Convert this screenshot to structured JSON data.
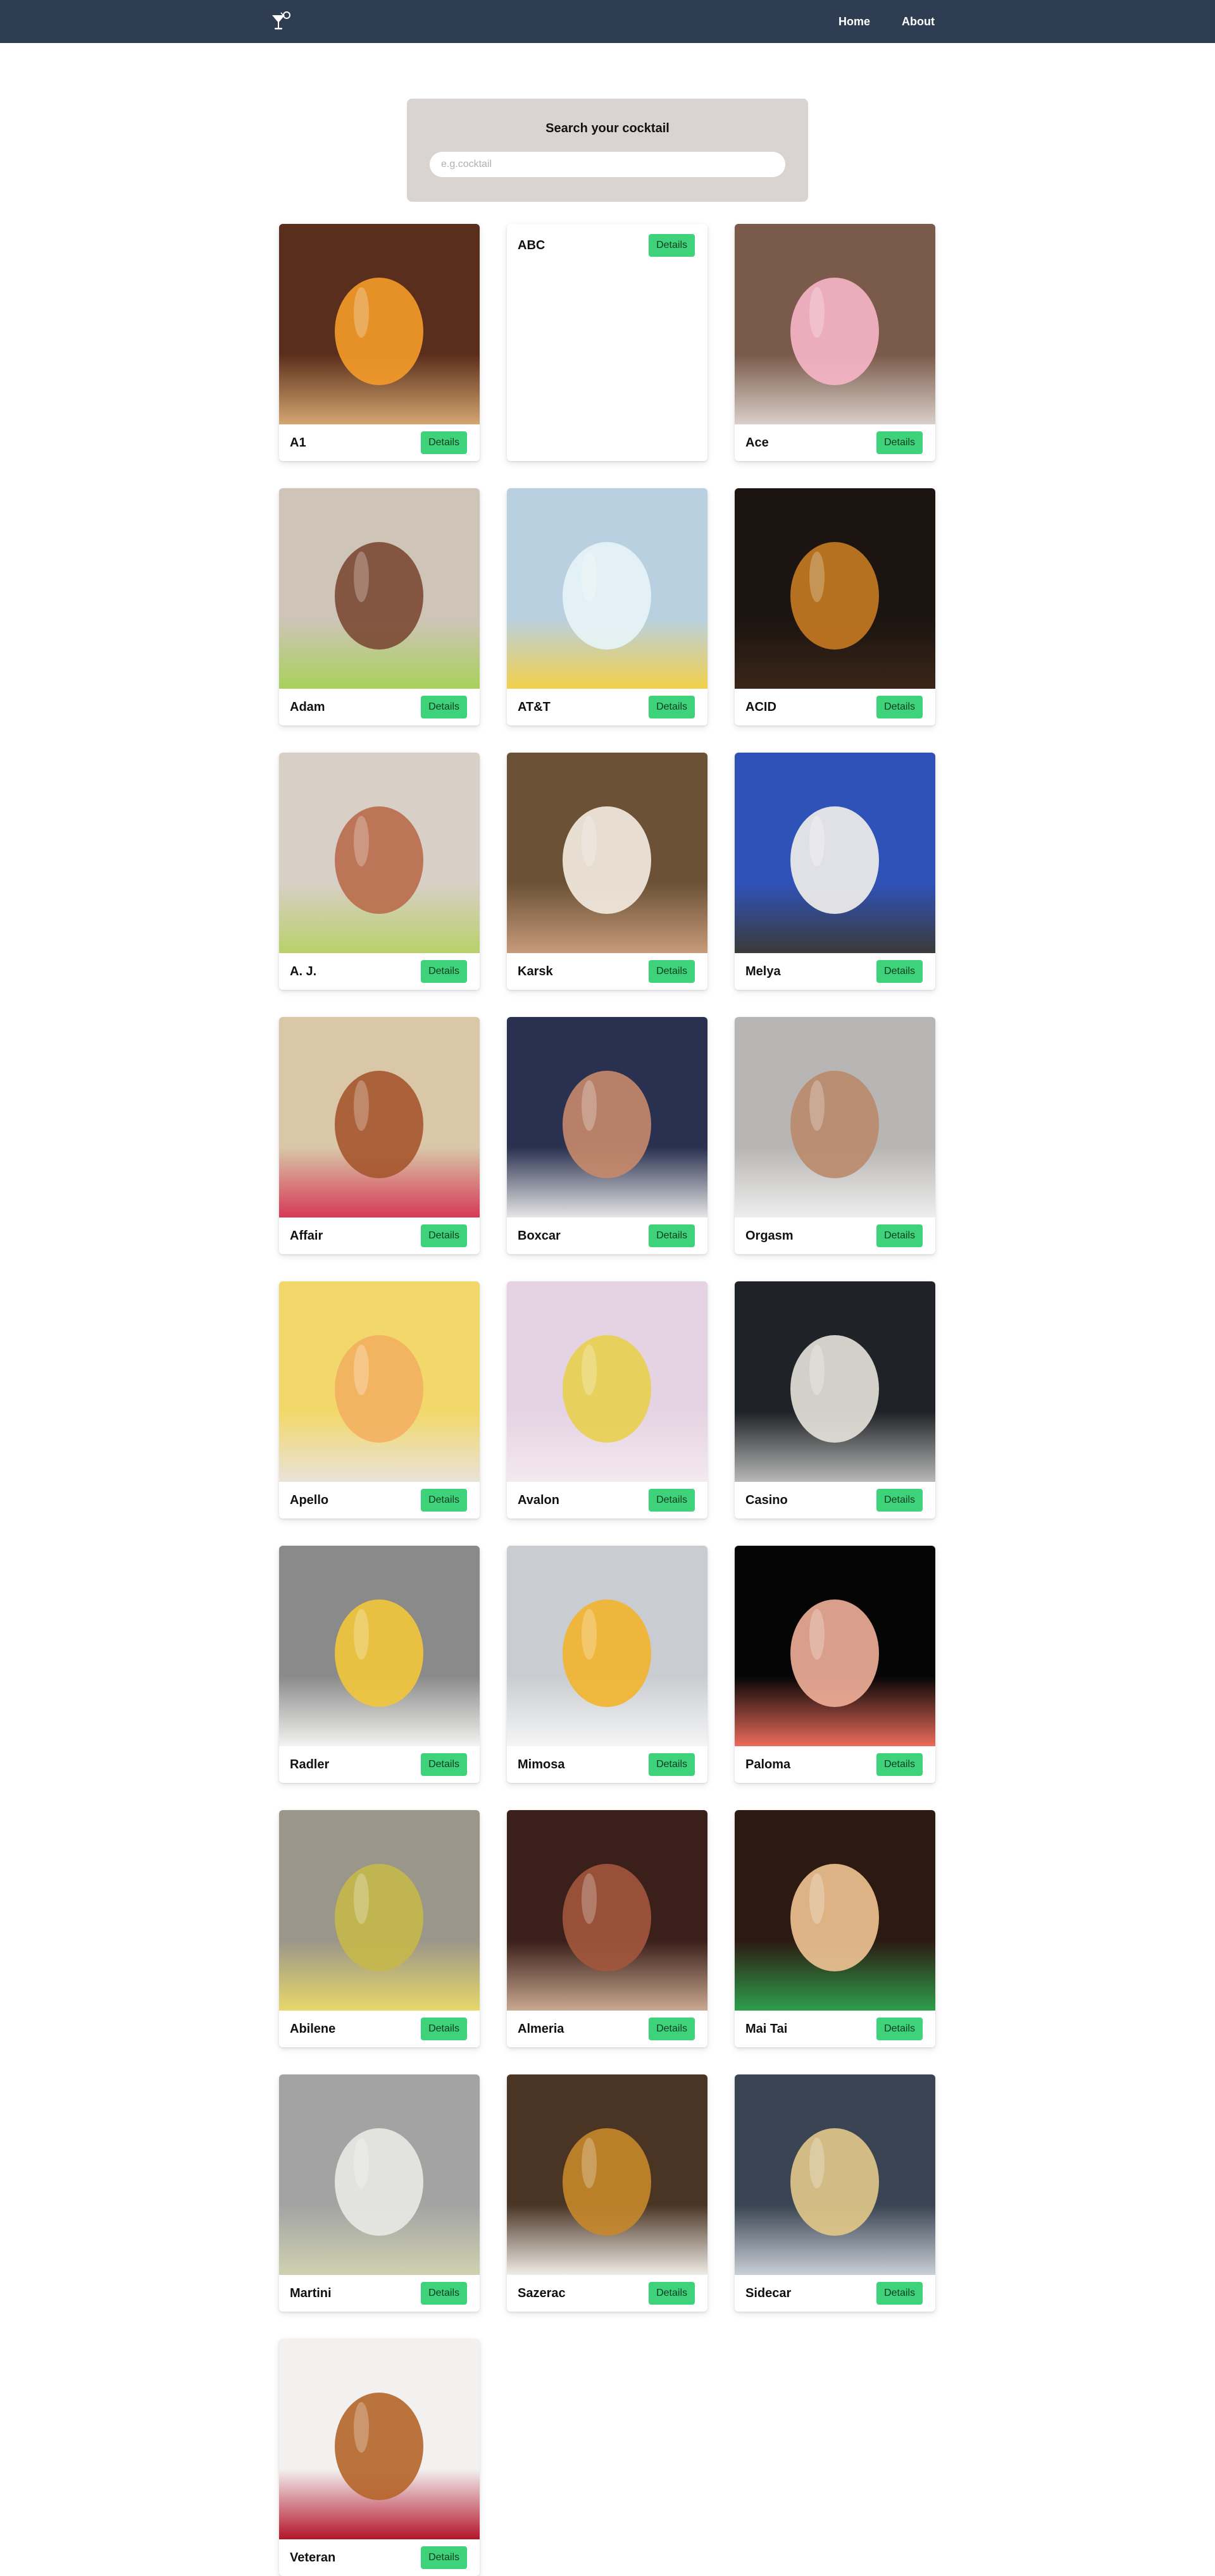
{
  "nav": {
    "logo_icon": "cocktail-glass-icon",
    "links": [
      "Home",
      "About"
    ]
  },
  "search": {
    "label": "Search your cocktail",
    "placeholder": "e.g.cocktail",
    "value": ""
  },
  "colors": {
    "navbar_bg": "#2f3d52",
    "search_panel_bg": "#d9d4d2",
    "details_button": "#3ed37a"
  },
  "details_label": "Details",
  "cocktails": [
    {
      "name": "A1",
      "has_image": true,
      "img": [
        "#5a2e1c",
        "#f59b2a",
        "#d4a670"
      ]
    },
    {
      "name": "ABC",
      "has_image": false,
      "img": null
    },
    {
      "name": "Ace",
      "has_image": true,
      "img": [
        "#7a5a4a",
        "#f7b6c8",
        "#d9cfc9"
      ]
    },
    {
      "name": "Adam",
      "has_image": true,
      "img": [
        "#cfc4b8",
        "#7b4a34",
        "#a8d15a"
      ]
    },
    {
      "name": "AT&T",
      "has_image": true,
      "img": [
        "#b9d0e0",
        "#e8f3f7",
        "#f2d04a"
      ]
    },
    {
      "name": "ACID",
      "has_image": true,
      "img": [
        "#1b1410",
        "#c77a22",
        "#3a2618"
      ]
    },
    {
      "name": "A. J.",
      "has_image": true,
      "img": [
        "#d8cfc6",
        "#b96c4a",
        "#b9d06a"
      ]
    },
    {
      "name": "Karsk",
      "has_image": true,
      "img": [
        "#6b5236",
        "#f5ece2",
        "#c89a7a"
      ]
    },
    {
      "name": "Melya",
      "has_image": true,
      "img": [
        "#2f52b8",
        "#f4f1ec",
        "#3b3a3a"
      ]
    },
    {
      "name": "Affair",
      "has_image": true,
      "img": [
        "#d9c7a8",
        "#a5562e",
        "#d63a57"
      ]
    },
    {
      "name": "Boxcar",
      "has_image": true,
      "img": [
        "#2a3150",
        "#c88a6a",
        "#e6e6e6"
      ]
    },
    {
      "name": "Orgasm",
      "has_image": true,
      "img": [
        "#b8b6b4",
        "#b98a6a",
        "#eeeeee"
      ]
    },
    {
      "name": "Apello",
      "has_image": true,
      "img": [
        "#f2d86a",
        "#f3b060",
        "#e9e2d9"
      ]
    },
    {
      "name": "Avalon",
      "has_image": true,
      "img": [
        "#e5d3e3",
        "#e8cf4c",
        "#f4e9ef"
      ]
    },
    {
      "name": "Casino",
      "has_image": true,
      "img": [
        "#1f2226",
        "#e6e3dc",
        "#b8b8b8"
      ]
    },
    {
      "name": "Radler",
      "has_image": true,
      "img": [
        "#8a8a8a",
        "#f2c63a",
        "#f3f3f1"
      ]
    },
    {
      "name": "Mimosa",
      "has_image": true,
      "img": [
        "#c9ccd0",
        "#f3b42c",
        "#f5f5f5"
      ]
    },
    {
      "name": "Paloma",
      "has_image": true,
      "img": [
        "#050505",
        "#f2b09a",
        "#eb6b5b"
      ]
    },
    {
      "name": "Abilene",
      "has_image": true,
      "img": [
        "#9b968a",
        "#c5b84a",
        "#e7d86a"
      ]
    },
    {
      "name": "Almeria",
      "has_image": true,
      "img": [
        "#3a1f1a",
        "#a3563c",
        "#c9a890"
      ]
    },
    {
      "name": "Mai Tai",
      "has_image": true,
      "img": [
        "#2c1a12",
        "#f1c494",
        "#2e9e4c"
      ]
    },
    {
      "name": "Martini",
      "has_image": true,
      "img": [
        "#a3a3a3",
        "#e9e9e6",
        "#cfd2b0"
      ]
    },
    {
      "name": "Sazerac",
      "has_image": true,
      "img": [
        "#4a3525",
        "#c7872a",
        "#f0ece6"
      ]
    },
    {
      "name": "Sidecar",
      "has_image": true,
      "img": [
        "#3a4452",
        "#e3c98a",
        "#c9cfd6"
      ]
    },
    {
      "name": "Veteran",
      "has_image": true,
      "img": [
        "#f2f1f0",
        "#b5652a",
        "#b3152a"
      ]
    }
  ]
}
